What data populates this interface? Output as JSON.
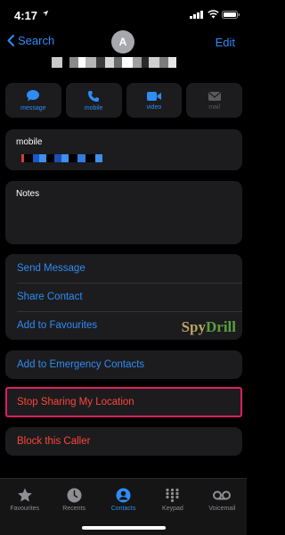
{
  "status": {
    "time": "4:17"
  },
  "nav": {
    "back_label": "Search",
    "avatar_initial": "A",
    "edit_label": "Edit"
  },
  "actions": [
    {
      "label": "message",
      "icon": "message-bubble-icon",
      "enabled": true
    },
    {
      "label": "mobile",
      "icon": "phone-icon",
      "enabled": true
    },
    {
      "label": "video",
      "icon": "video-camera-icon",
      "enabled": true
    },
    {
      "label": "mail",
      "icon": "mail-envelope-icon",
      "enabled": false
    }
  ],
  "phone": {
    "label": "mobile"
  },
  "notes": {
    "label": "Notes"
  },
  "list": {
    "send_message": "Send Message",
    "share_contact": "Share Contact",
    "add_favourites": "Add to Favourites"
  },
  "watermark": {
    "part1": "Spy",
    "part2": "Drill"
  },
  "emergency": {
    "label": "Add to Emergency Contacts"
  },
  "stop_sharing": {
    "label": "Stop Sharing My Location"
  },
  "block": {
    "label": "Block this Caller"
  },
  "tabs": [
    {
      "label": "Favourites",
      "icon": "star-icon",
      "active": false
    },
    {
      "label": "Recents",
      "icon": "clock-icon",
      "active": false
    },
    {
      "label": "Contacts",
      "icon": "person-circle-icon",
      "active": true
    },
    {
      "label": "Keypad",
      "icon": "keypad-grid-icon",
      "active": false
    },
    {
      "label": "Voicemail",
      "icon": "voicemail-icon",
      "active": false
    }
  ],
  "colors": {
    "accent": "#2f8cf4",
    "destructive": "#ff453a",
    "highlight": "#e01d63",
    "card": "#1c1c1e"
  }
}
